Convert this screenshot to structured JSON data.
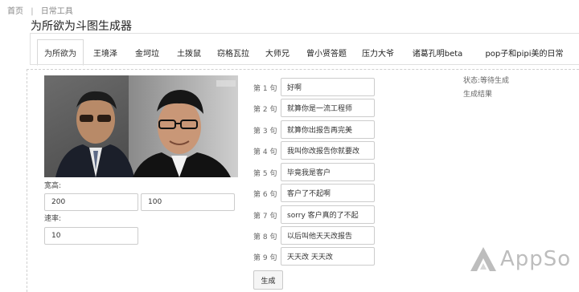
{
  "breadcrumb": {
    "home": "首页",
    "separator": "|",
    "current": "日常工具"
  },
  "page_title": "为所欲为斗图生成器",
  "tabs": [
    {
      "label": "为所欲为",
      "active": true
    },
    {
      "label": "王境泽",
      "active": false
    },
    {
      "label": "金坷垃",
      "active": false
    },
    {
      "label": "土拨鼠",
      "active": false
    },
    {
      "label": "窃格瓦拉",
      "active": false
    },
    {
      "label": "大师兄",
      "active": false
    },
    {
      "label": "曾小贤答题",
      "active": false
    },
    {
      "label": "压力大爷",
      "active": false
    },
    {
      "label": "诸葛孔明beta",
      "active": false
    },
    {
      "label": "pop子和pipi美的日常",
      "active": false
    }
  ],
  "form": {
    "size_label": "宽高:",
    "width": "200",
    "height": "100",
    "rate_label": "速率:",
    "rate": "10"
  },
  "sentences": [
    {
      "label": "第 1 句",
      "value": "好啊"
    },
    {
      "label": "第 2 句",
      "value": "就算你是一流工程师"
    },
    {
      "label": "第 3 句",
      "value": "就算你出报告再完美"
    },
    {
      "label": "第 4 句",
      "value": "我叫你改报告你就要改"
    },
    {
      "label": "第 5 句",
      "value": "毕竟我是客户"
    },
    {
      "label": "第 6 句",
      "value": "客户了不起啊"
    },
    {
      "label": "第 7 句",
      "value": "sorry 客户真的了不起"
    },
    {
      "label": "第 8 句",
      "value": "以后叫他天天改报告"
    },
    {
      "label": "第 9 句",
      "value": "天天改 天天改"
    }
  ],
  "generate_label": "生成",
  "status": {
    "state": "状态:等待生成",
    "result": "生成结果"
  },
  "watermark": "AppSo",
  "colors": {
    "border": "#cccccc",
    "watermark": "#bdbdbd"
  }
}
